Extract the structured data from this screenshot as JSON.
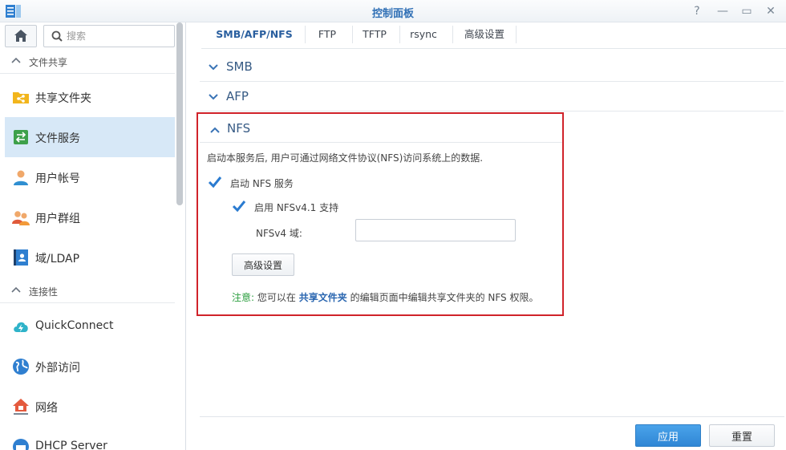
{
  "window": {
    "title": "控制面板",
    "controls": {
      "help": "?",
      "minimize": "—",
      "maximize": "▭",
      "close": "✕"
    }
  },
  "sidebar": {
    "search_placeholder": "搜索",
    "groups": [
      {
        "label": "文件共享",
        "expanded": true
      },
      {
        "label": "连接性",
        "expanded": true
      }
    ],
    "items": [
      {
        "label": "共享文件夹",
        "icon": "shared-folder-icon",
        "active": false
      },
      {
        "label": "文件服务",
        "icon": "file-services-icon",
        "active": true
      },
      {
        "label": "用户帐号",
        "icon": "user-icon",
        "active": false
      },
      {
        "label": "用户群组",
        "icon": "group-icon",
        "active": false
      },
      {
        "label": "域/LDAP",
        "icon": "domain-ldap-icon",
        "active": false
      },
      {
        "label": "QuickConnect",
        "icon": "quickconnect-icon",
        "active": false
      },
      {
        "label": "外部访问",
        "icon": "globe-icon",
        "active": false
      },
      {
        "label": "网络",
        "icon": "network-icon",
        "active": false
      },
      {
        "label": "DHCP Server",
        "icon": "dhcp-icon",
        "active": false
      }
    ]
  },
  "tabs": [
    {
      "label": "SMB/AFP/NFS",
      "active": true
    },
    {
      "label": "FTP",
      "active": false
    },
    {
      "label": "TFTP",
      "active": false
    },
    {
      "label": "rsync",
      "active": false
    },
    {
      "label": "高级设置",
      "active": false
    }
  ],
  "sections": {
    "smb": {
      "title": "SMB",
      "expanded": false
    },
    "afp": {
      "title": "AFP",
      "expanded": false
    },
    "nfs": {
      "title": "NFS",
      "expanded": true,
      "description": "启动本服务后, 用户可通过网络文件协议(NFS)访问系统上的数据.",
      "enable_nfs": {
        "label": "启动 NFS 服务",
        "checked": true
      },
      "enable_nfsv41": {
        "label": "启用 NFSv4.1 支持",
        "checked": true
      },
      "nfsv4_domain": {
        "label": "NFSv4 域:",
        "value": ""
      },
      "advanced_button": "高级设置",
      "note": {
        "prefix": "注意:",
        "before_link": "您可以在",
        "link": "共享文件夹",
        "after_link": "的编辑页面中编辑共享文件夹的 NFS 权限。"
      }
    }
  },
  "footer": {
    "apply": "应用",
    "reset": "重置"
  },
  "colors": {
    "accent": "#2f86d5",
    "highlight_border": "#d0232a",
    "active_nav": "#d7e8f7",
    "note_green": "#2b9e3f"
  }
}
